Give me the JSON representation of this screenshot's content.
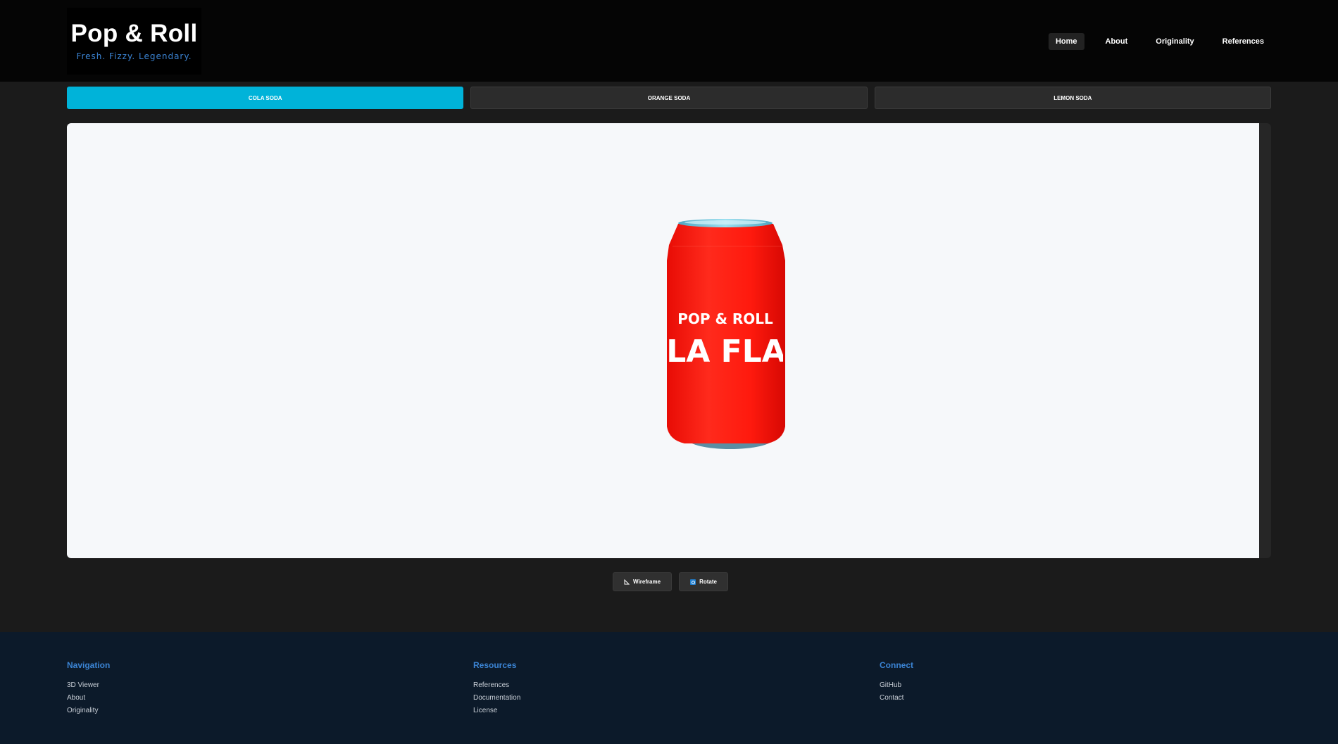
{
  "brand": {
    "title": "Pop & Roll",
    "tagline": "Fresh. Fizzy. Legendary."
  },
  "nav": {
    "items": [
      {
        "label": "Home",
        "active": true
      },
      {
        "label": "About",
        "active": false
      },
      {
        "label": "Originality",
        "active": false
      },
      {
        "label": "References",
        "active": false
      }
    ]
  },
  "tabs": [
    {
      "label": "COLA SODA",
      "active": true
    },
    {
      "label": "ORANGE SODA",
      "active": false
    },
    {
      "label": "LEMON SODA",
      "active": false
    }
  ],
  "viewer": {
    "can": {
      "brand_text": "POP & ROLL",
      "flavor_text": "COLA FLAVO",
      "body_color": "#ff1a0e",
      "rim_color": "#6fc3dc"
    }
  },
  "controls": {
    "wireframe_label": "Wireframe",
    "rotate_label": "Rotate",
    "wireframe_icon": "wireframe-icon",
    "rotate_icon": "rotate-icon"
  },
  "footer": {
    "navigation": {
      "heading": "Navigation",
      "links": [
        "3D Viewer",
        "About",
        "Originality"
      ]
    },
    "resources": {
      "heading": "Resources",
      "links": [
        "References",
        "Documentation",
        "License"
      ]
    },
    "connect": {
      "heading": "Connect",
      "links": [
        "GitHub",
        "Contact"
      ]
    }
  },
  "colors": {
    "accent": "#00b3d9",
    "link_heading": "#3b84d4",
    "header_bg": "#050505",
    "footer_bg": "#0c1a2a"
  }
}
